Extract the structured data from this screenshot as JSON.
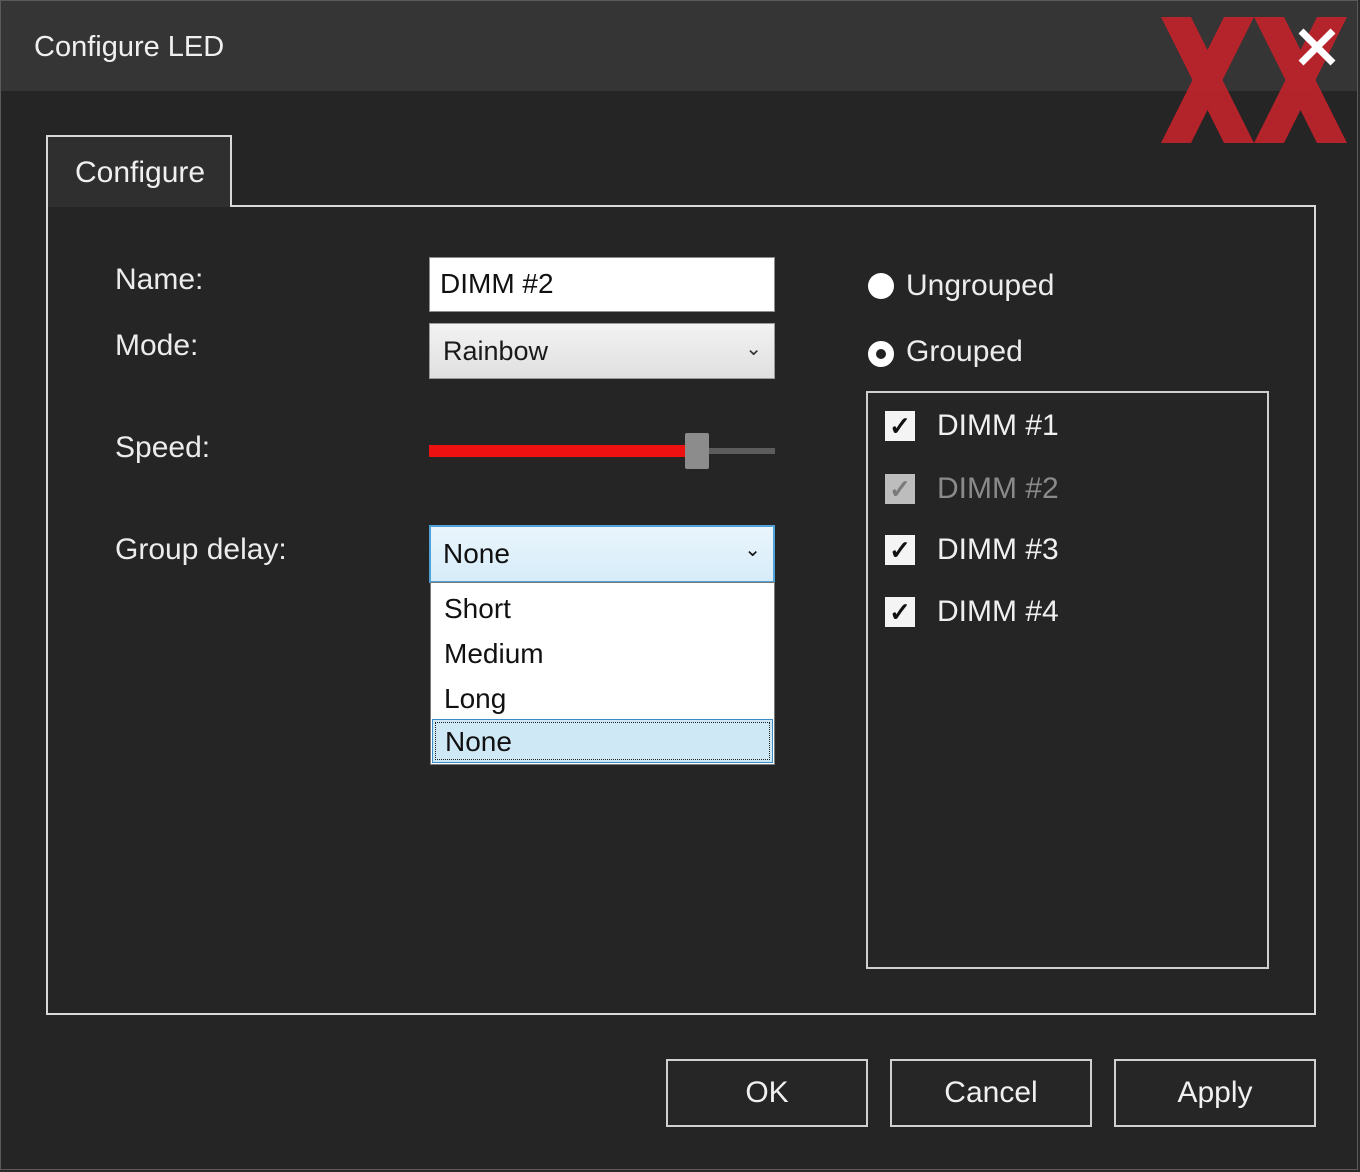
{
  "window": {
    "title": "Configure LED",
    "close_icon": "close-icon"
  },
  "tabs": [
    {
      "label": "Configure",
      "selected": true
    }
  ],
  "form": {
    "name_label": "Name:",
    "name_value": "DIMM #2",
    "mode_label": "Mode:",
    "mode_value": "Rainbow",
    "speed_label": "Speed:",
    "speed_level": 0.77,
    "group_delay_label": "Group delay:",
    "group_delay_value": "None",
    "group_delay_options": [
      "Short",
      "Medium",
      "Long",
      "None"
    ]
  },
  "grouping": {
    "ungrouped_label": "Ungrouped",
    "grouped_label": "Grouped",
    "selected": "Grouped",
    "items": [
      {
        "label": "DIMM #1",
        "checked": true,
        "enabled": true
      },
      {
        "label": "DIMM #2",
        "checked": true,
        "enabled": false
      },
      {
        "label": "DIMM #3",
        "checked": true,
        "enabled": true
      },
      {
        "label": "DIMM #4",
        "checked": true,
        "enabled": true
      }
    ]
  },
  "buttons": {
    "ok": "OK",
    "cancel": "Cancel",
    "apply": "Apply"
  },
  "colors": {
    "slider_fill": "#ee1111",
    "logo_red": "#c0232b",
    "selection": "#cfe8f5"
  }
}
